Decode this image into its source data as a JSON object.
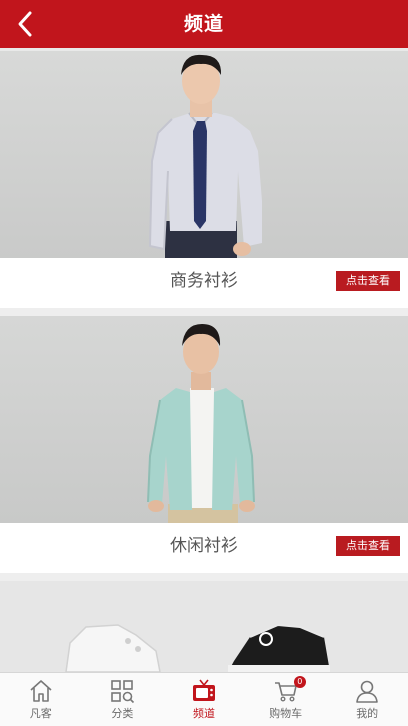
{
  "header": {
    "title": "频道",
    "background_color": "#c1151c",
    "back_icon": "chevron-left-icon"
  },
  "channels": [
    {
      "caption": "商务衬衫",
      "button_label": "点击查看"
    },
    {
      "caption": "休闲衬衫",
      "button_label": "点击查看"
    },
    {
      "caption": "",
      "button_label": ""
    }
  ],
  "tabbar": {
    "items": [
      {
        "label": "凡客",
        "icon": "home-icon",
        "active": false
      },
      {
        "label": "分类",
        "icon": "category-grid-icon",
        "active": false
      },
      {
        "label": "频道",
        "icon": "tv-channel-icon",
        "active": true
      },
      {
        "label": "购物车",
        "icon": "cart-icon",
        "active": false,
        "badge": "0"
      },
      {
        "label": "我的",
        "icon": "user-icon",
        "active": false
      }
    ],
    "active_color": "#c1151c"
  }
}
